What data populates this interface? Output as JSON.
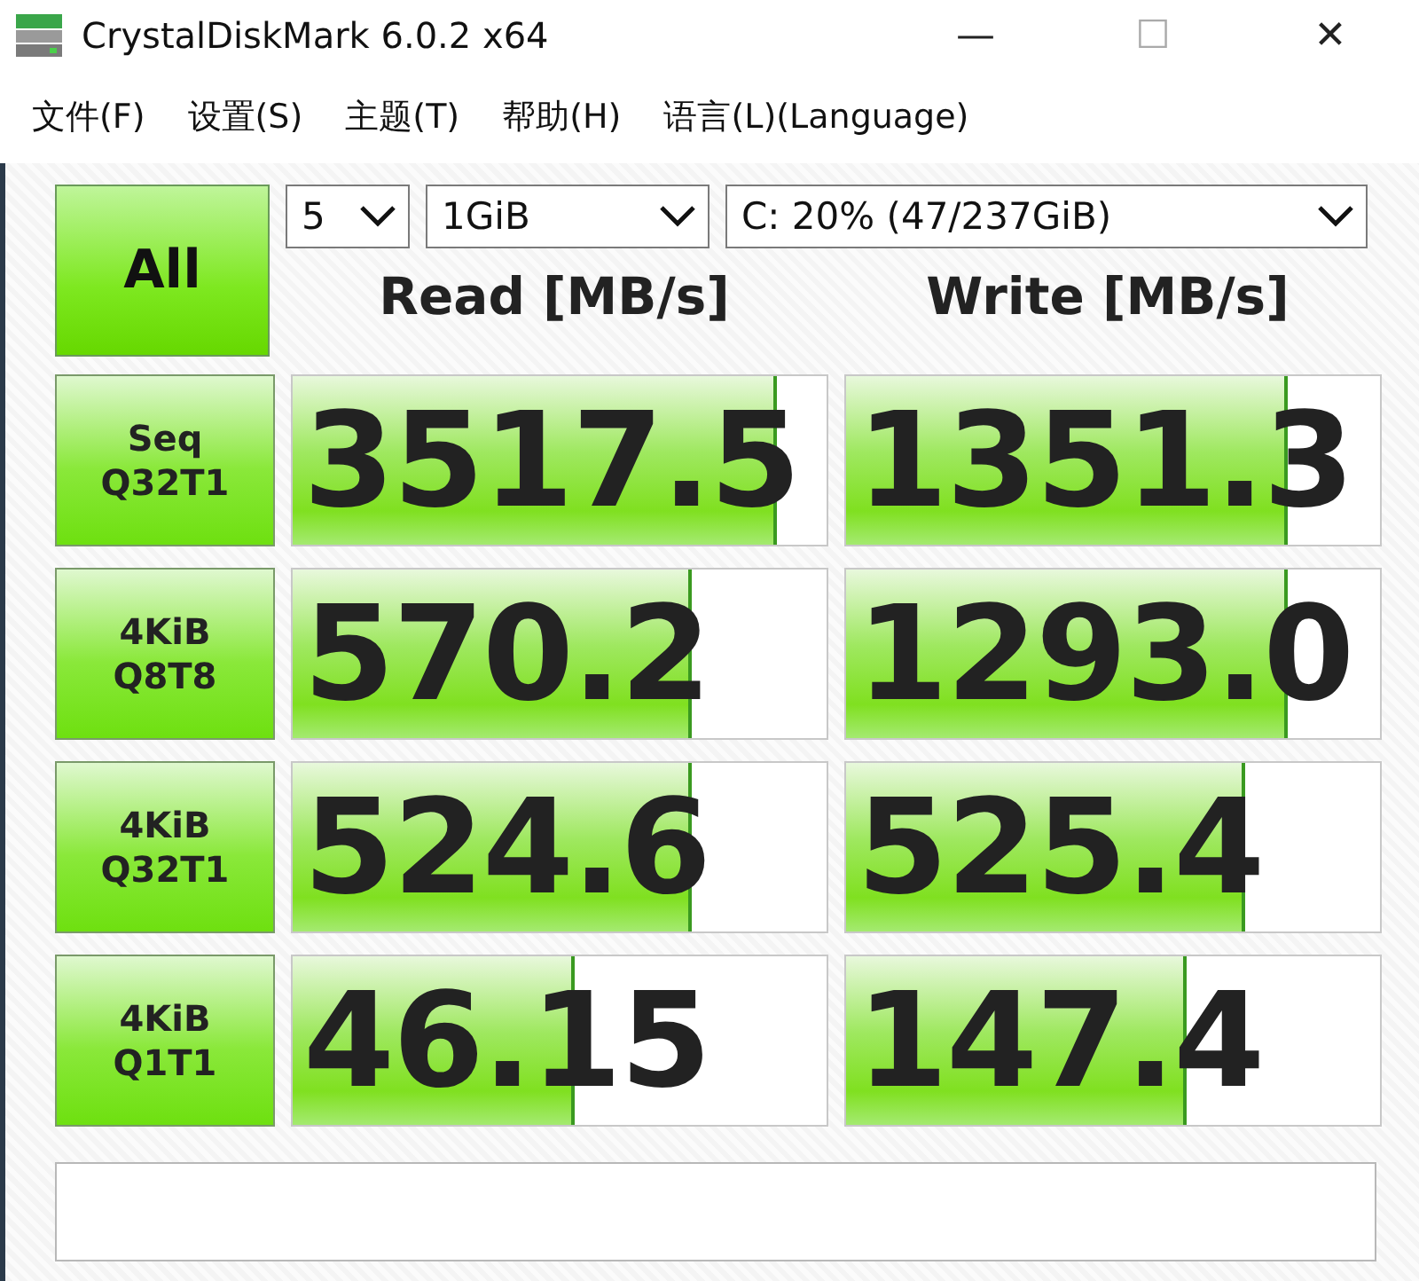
{
  "window": {
    "title": "CrystalDiskMark 6.0.2 x64",
    "controls": [
      "—",
      "☐",
      "✕"
    ]
  },
  "menu": [
    "文件(F)",
    "设置(S)",
    "主题(T)",
    "帮助(H)",
    "语言(L)(Language)"
  ],
  "all_button": "All",
  "selectors": [
    {
      "value": "5"
    },
    {
      "value": "1GiB"
    },
    {
      "value": "C: 20% (47/237GiB)"
    }
  ],
  "headers": [
    "Read [MB/s]",
    "Write [MB/s]"
  ],
  "tests": [
    {
      "label": [
        "Seq",
        "Q32T1"
      ],
      "read": {
        "value": "3517.5",
        "level": 0.9
      },
      "write": {
        "value": "1351.3",
        "level": 0.82
      }
    },
    {
      "label": [
        "4KiB",
        "Q8T8"
      ],
      "read": {
        "value": "570.2",
        "level": 0.74
      },
      "write": {
        "value": "1293.0",
        "level": 0.82
      }
    },
    {
      "label": [
        "4KiB",
        "Q32T1"
      ],
      "read": {
        "value": "524.6",
        "level": 0.74
      },
      "write": {
        "value": "525.4",
        "level": 0.74
      }
    },
    {
      "label": [
        "4KiB",
        "Q1T1"
      ],
      "read": {
        "value": "46.15",
        "level": 0.52
      },
      "write": {
        "value": "147.4",
        "level": 0.63
      }
    }
  ]
}
